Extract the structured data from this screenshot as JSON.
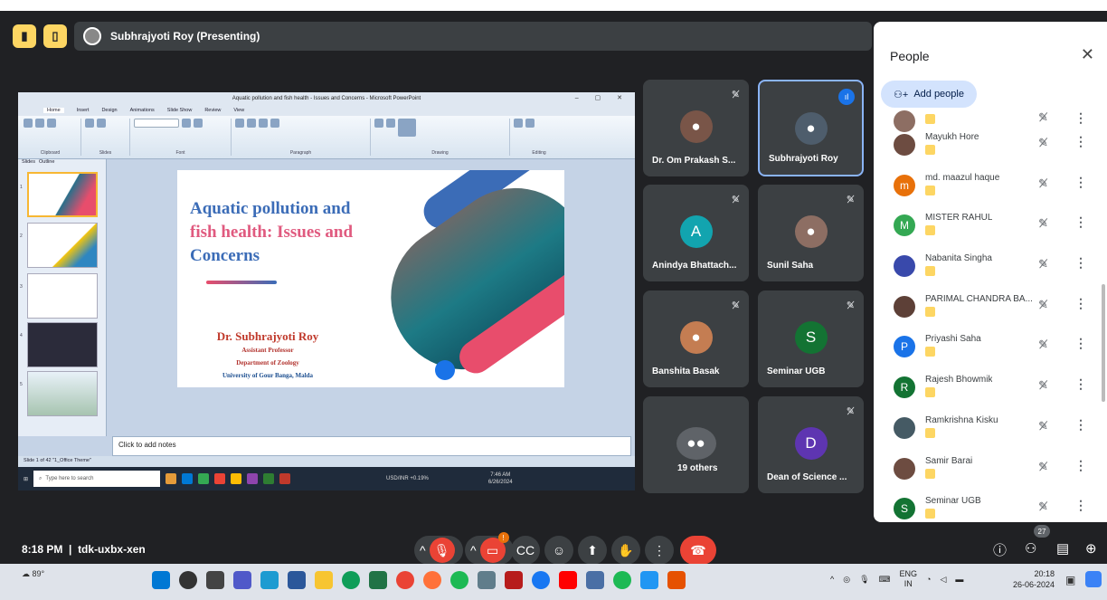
{
  "presenter_bar": {
    "label": "Subhrajyoti Roy (Presenting)"
  },
  "shared_screen": {
    "window_title": "Aquatic pollution and fish health - Issues and Concerns - Microsoft PowerPoint",
    "ribbon_tabs": [
      "Home",
      "Insert",
      "Design",
      "Animations",
      "Slide Show",
      "Review",
      "View"
    ],
    "ribbon_groups": [
      "Clipboard",
      "Slides",
      "Font",
      "Paragraph",
      "Drawing",
      "Editing"
    ],
    "thumb_tabs": [
      "Slides",
      "Outline"
    ],
    "slide": {
      "title_line1": "Aquatic pollution and",
      "title_line2": "fish health: Issues and",
      "title_line3": "Concerns",
      "author": "Dr. Subhrajyoti Roy",
      "role": "Assistant Professor",
      "dept": "Department of Zoology",
      "univ": "University of Gour Banga, Malda"
    },
    "notes_placeholder": "Click to add notes",
    "status_text": "Slide 1 of 42   \"1_Office Theme\"",
    "taskbar_search": "Type here to search",
    "ticker": "USD/INR +0.19%",
    "clock_time": "7:46 AM",
    "clock_date": "6/26/2024"
  },
  "tiles": [
    {
      "name": "Dr. Om Prakash S...",
      "color": "#5f6368"
    },
    {
      "name": "Subhrajyoti Roy",
      "color": "#5f6368"
    },
    {
      "name": "Anindya Bhattach...",
      "initial": "A",
      "color": "#12a4af"
    },
    {
      "name": "Sunil Saha",
      "color": "#5f6368"
    },
    {
      "name": "Banshita Basak",
      "color": "#5f6368"
    },
    {
      "name": "Seminar UGB",
      "initial": "S",
      "color": "#137333"
    },
    {
      "name": "19 others",
      "color": "#5f6368"
    },
    {
      "name": "Dean of Science ...",
      "initial": "D",
      "color": "#5e35b1"
    }
  ],
  "people_panel": {
    "title": "People",
    "add_label": "Add people",
    "participants": [
      {
        "name": "",
        "color": "#8d6e63"
      },
      {
        "name": "Mayukh Hore",
        "color": "#6d4c41"
      },
      {
        "name": "md. maazul haque",
        "initial": "m",
        "color": "#e8710a"
      },
      {
        "name": "MISTER RAHUL",
        "initial": "M",
        "color": "#34a853"
      },
      {
        "name": "Nabanita Singha",
        "color": "#3949ab"
      },
      {
        "name": "PARIMAL CHANDRA BA...",
        "color": "#5d4037"
      },
      {
        "name": "Priyashi Saha",
        "initial": "P",
        "color": "#1a73e8"
      },
      {
        "name": "Rajesh Bhowmik",
        "initial": "R",
        "color": "#137333"
      },
      {
        "name": "Ramkrishna Kisku",
        "color": "#455a64"
      },
      {
        "name": "Samir Barai",
        "color": "#6d4c41"
      },
      {
        "name": "Seminar UGB",
        "initial": "S",
        "color": "#137333"
      }
    ]
  },
  "meeting": {
    "time": "8:18 PM",
    "code": "tdk-uxbx-xen",
    "participant_count": "27",
    "notification_count": "!"
  },
  "windows": {
    "weather": "89°",
    "lang1": "ENG",
    "lang2": "IN",
    "time": "20:18",
    "date": "26-06-2024"
  }
}
